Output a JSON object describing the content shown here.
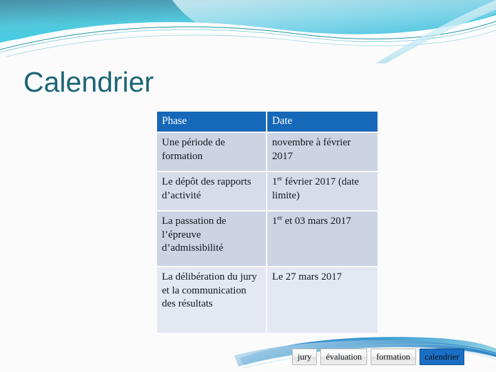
{
  "slide": {
    "title": "Calendrier",
    "title_color": "#1b6576",
    "background_color": "#fbfbfb",
    "accent_color": "#1668b8",
    "wave_colors": [
      "#3ad5e5",
      "#7fd9ea",
      "#1b9bbd",
      "#1668b8",
      "#ffffff"
    ]
  },
  "table": {
    "header": {
      "phase": "Phase",
      "date": "Date",
      "background_color": "#1668b8",
      "text_color": "#ffffff"
    },
    "rows": [
      {
        "phase": "Une période de formation",
        "date_prefix": "",
        "date_sup": "",
        "date_suffix": "novembre à février 2017"
      },
      {
        "phase": "Le dépôt des rapports d’activité",
        "date_prefix": "1",
        "date_sup": "er",
        "date_suffix": " février 2017 (date limite)"
      },
      {
        "phase": "La passation de l’épreuve d’admissibilité",
        "date_prefix": "1",
        "date_sup": "er",
        "date_suffix": " et  03 mars 2017"
      },
      {
        "phase": "La délibération du jury et la communication des résultats",
        "date_prefix": "",
        "date_sup": "",
        "date_suffix": "Le 27 mars 2017"
      }
    ]
  },
  "tags": [
    {
      "label": "jury",
      "active": false
    },
    {
      "label": "évaluation",
      "active": false
    },
    {
      "label": "formation",
      "active": false
    },
    {
      "label": "calendrier",
      "active": true
    }
  ]
}
